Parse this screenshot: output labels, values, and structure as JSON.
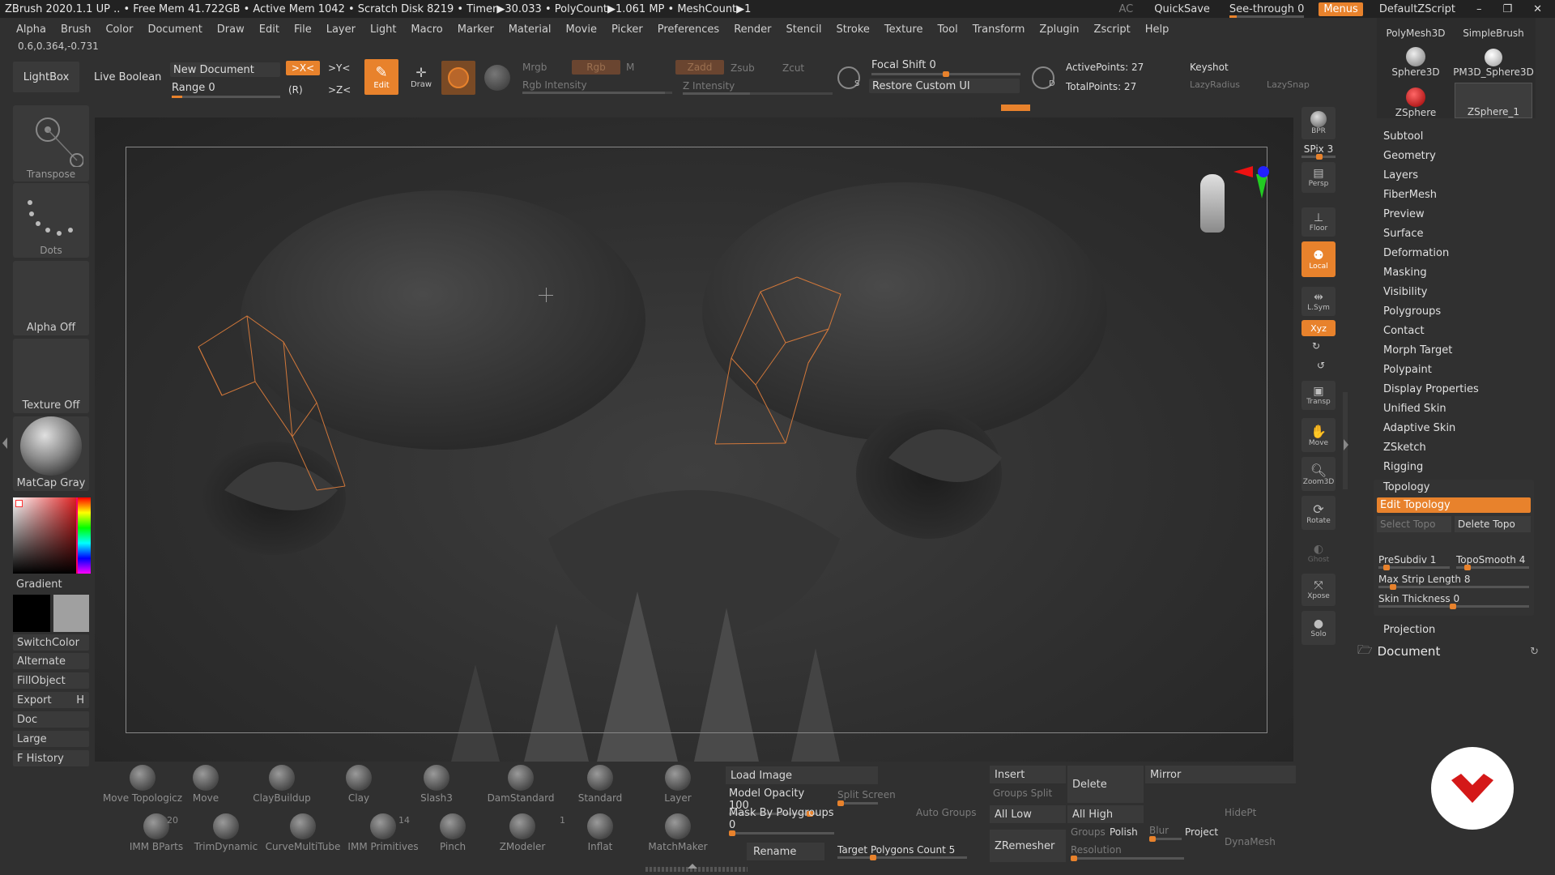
{
  "titlebar": {
    "status": "ZBrush 2020.1.1   UP   .. • Free Mem 41.722GB • Active Mem 1042 • Scratch Disk 8219 • Timer▶30.033 • PolyCount▶1.061 MP • MeshCount▶1",
    "ac": "AC",
    "quicksave": "QuickSave",
    "see_through": "See-through  0",
    "menus": "Menus",
    "script": "DefaultZScript"
  },
  "menubar": [
    "Alpha",
    "Brush",
    "Color",
    "Document",
    "Draw",
    "Edit",
    "File",
    "Layer",
    "Light",
    "Macro",
    "Marker",
    "Material",
    "Movie",
    "Picker",
    "Preferences",
    "Render",
    "Stencil",
    "Stroke",
    "Texture",
    "Tool",
    "Transform",
    "Zplugin",
    "Zscript",
    "Help"
  ],
  "vertex_readout": "0.6,0.364,-0.731",
  "top_shelf": {
    "lightbox": "LightBox",
    "live_boolean": "Live Boolean",
    "new_document": "New Document",
    "range": "Range 0",
    "sym_x": ">X<",
    "sym_y": ">Y<",
    "sym_z": ">Z<",
    "sym_r": "(R)",
    "edit": "Edit",
    "draw": "Draw",
    "mrgb": "Mrgb",
    "rgb": "Rgb",
    "m": "M",
    "rgb_intensity": "Rgb Intensity",
    "zadd": "Zadd",
    "zsub": "Zsub",
    "zcut": "Zcut",
    "z_intensity": "Z Intensity",
    "focal_shift": "Focal Shift 0",
    "restore_ui": "Restore Custom UI",
    "active_points": "ActivePoints: 27",
    "total_points": "TotalPoints: 27",
    "keyshot": "Keyshot",
    "lazy_radius": "LazyRadius",
    "lazy_snap": "LazySnap",
    "s_label": "S",
    "d_label": "D"
  },
  "left_panel": {
    "transpose": "Transpose",
    "dots": "Dots",
    "alpha_off": "Alpha Off",
    "texture_off": "Texture Off",
    "matcap": "MatCap Gray",
    "gradient": "Gradient",
    "switch_color": "SwitchColor",
    "alternate": "Alternate",
    "fill_object": "FillObject",
    "export": "Export",
    "export_key": "H",
    "doc": "Doc",
    "large": "Large",
    "f_history": "F History"
  },
  "right_toolbar": [
    "BPR",
    "SPix 3",
    "Persp",
    "Floor",
    "Local",
    "L.Sym",
    "Xyz",
    "Transp",
    "Move",
    "Zoom3D",
    "Rotate",
    "Ghost",
    "Xpose",
    "Solo"
  ],
  "tool_thumbs": [
    "PolyMesh3D",
    "SimpleBrush",
    "Sphere3D",
    "PM3D_Sphere3D",
    "ZSphere",
    "ZSphere_1"
  ],
  "tool_menu": {
    "items": [
      "Subtool",
      "Geometry",
      "Layers",
      "FiberMesh",
      "Preview",
      "Surface",
      "Deformation",
      "Masking",
      "Visibility",
      "Polygroups",
      "Contact",
      "Morph Target",
      "Polypaint",
      "Display Properties",
      "Unified Skin",
      "Adaptive Skin",
      "ZSketch",
      "Rigging",
      "Topology"
    ],
    "edit_topology": "Edit Topology",
    "select_topo": "Select Topo",
    "delete_topo": "Delete Topo",
    "presubdiv": "PreSubdiv 1",
    "toposmooth": "TopoSmooth 4",
    "max_strip": "Max Strip Length 8",
    "skin_thickness": "Skin Thickness 0",
    "projection": "Projection",
    "document": "Document"
  },
  "bottom_brushes": [
    {
      "name": "Move Topologicz",
      "count": ""
    },
    {
      "name": "Move",
      "count": ""
    },
    {
      "name": "ClayBuildup",
      "count": ""
    },
    {
      "name": "Clay",
      "count": ""
    },
    {
      "name": "Slash3",
      "count": ""
    },
    {
      "name": "DamStandard",
      "count": ""
    },
    {
      "name": "Standard",
      "count": ""
    },
    {
      "name": "Layer",
      "count": ""
    },
    {
      "name": "IMM BParts",
      "count": "20"
    },
    {
      "name": "TrimDynamic",
      "count": ""
    },
    {
      "name": "CurveMultiTube",
      "count": ""
    },
    {
      "name": "IMM Primitives",
      "count": "14"
    },
    {
      "name": "Pinch",
      "count": ""
    },
    {
      "name": "ZModeler",
      "count": "1"
    },
    {
      "name": "Inflat",
      "count": ""
    },
    {
      "name": "MatchMaker",
      "count": ""
    }
  ],
  "bottom_tools": {
    "load_image": "Load Image",
    "model_opacity": "Model Opacity 100",
    "split_screen": "Split Screen",
    "mask_polygroups": "Mask By Polygroups 0",
    "auto_groups": "Auto Groups",
    "rename": "Rename",
    "target_polygons": "Target Polygons Count 5",
    "insert": "Insert",
    "delete": "Delete",
    "mirror": "Mirror",
    "groups_split": "Groups Split",
    "all_low": "All Low",
    "all_high": "All High",
    "hidept": "HidePt",
    "zremesher": "ZRemesher",
    "groups": "Groups",
    "polish": "Polish",
    "blur": "Blur",
    "project": "Project",
    "dynamesh": "DynaMesh",
    "resolution": "Resolution"
  },
  "colors": {
    "accent": "#e8822c",
    "panel": "#3a3a3a",
    "bg": "#303030"
  }
}
